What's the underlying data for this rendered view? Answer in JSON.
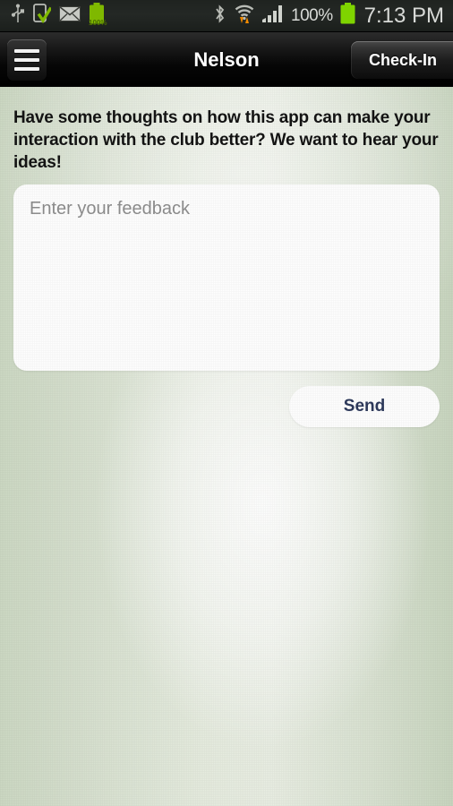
{
  "statusbar": {
    "icons_left": [
      "usb-icon",
      "device-download-check-icon",
      "email-icon",
      "battery-icon"
    ],
    "icons_right": [
      "bluetooth-icon",
      "wifi-transfer-icon",
      "cellular-signal-icon"
    ],
    "battery_percent": "100%",
    "battery_label": "100%",
    "clock": "7:13 PM"
  },
  "actionbar": {
    "menu_icon": "hamburger-menu-icon",
    "title": "Nelson",
    "checkin_label": "Check-In"
  },
  "main": {
    "prompt": "Have some thoughts on how this app can make your interaction with the club better? We want to hear your ideas!",
    "feedback": {
      "value": "",
      "placeholder": "Enter your feedback"
    },
    "send_label": "Send"
  },
  "colors": {
    "statusbar_bg": "#22261f",
    "actionbar_bg": "#000000",
    "content_bg_edge": "#cdd9c4",
    "content_bg_center": "#f2f5ee",
    "battery_green": "#8ac926",
    "send_text": "#2e3a5c",
    "title_text": "#ffffff",
    "prompt_text": "#141414"
  }
}
